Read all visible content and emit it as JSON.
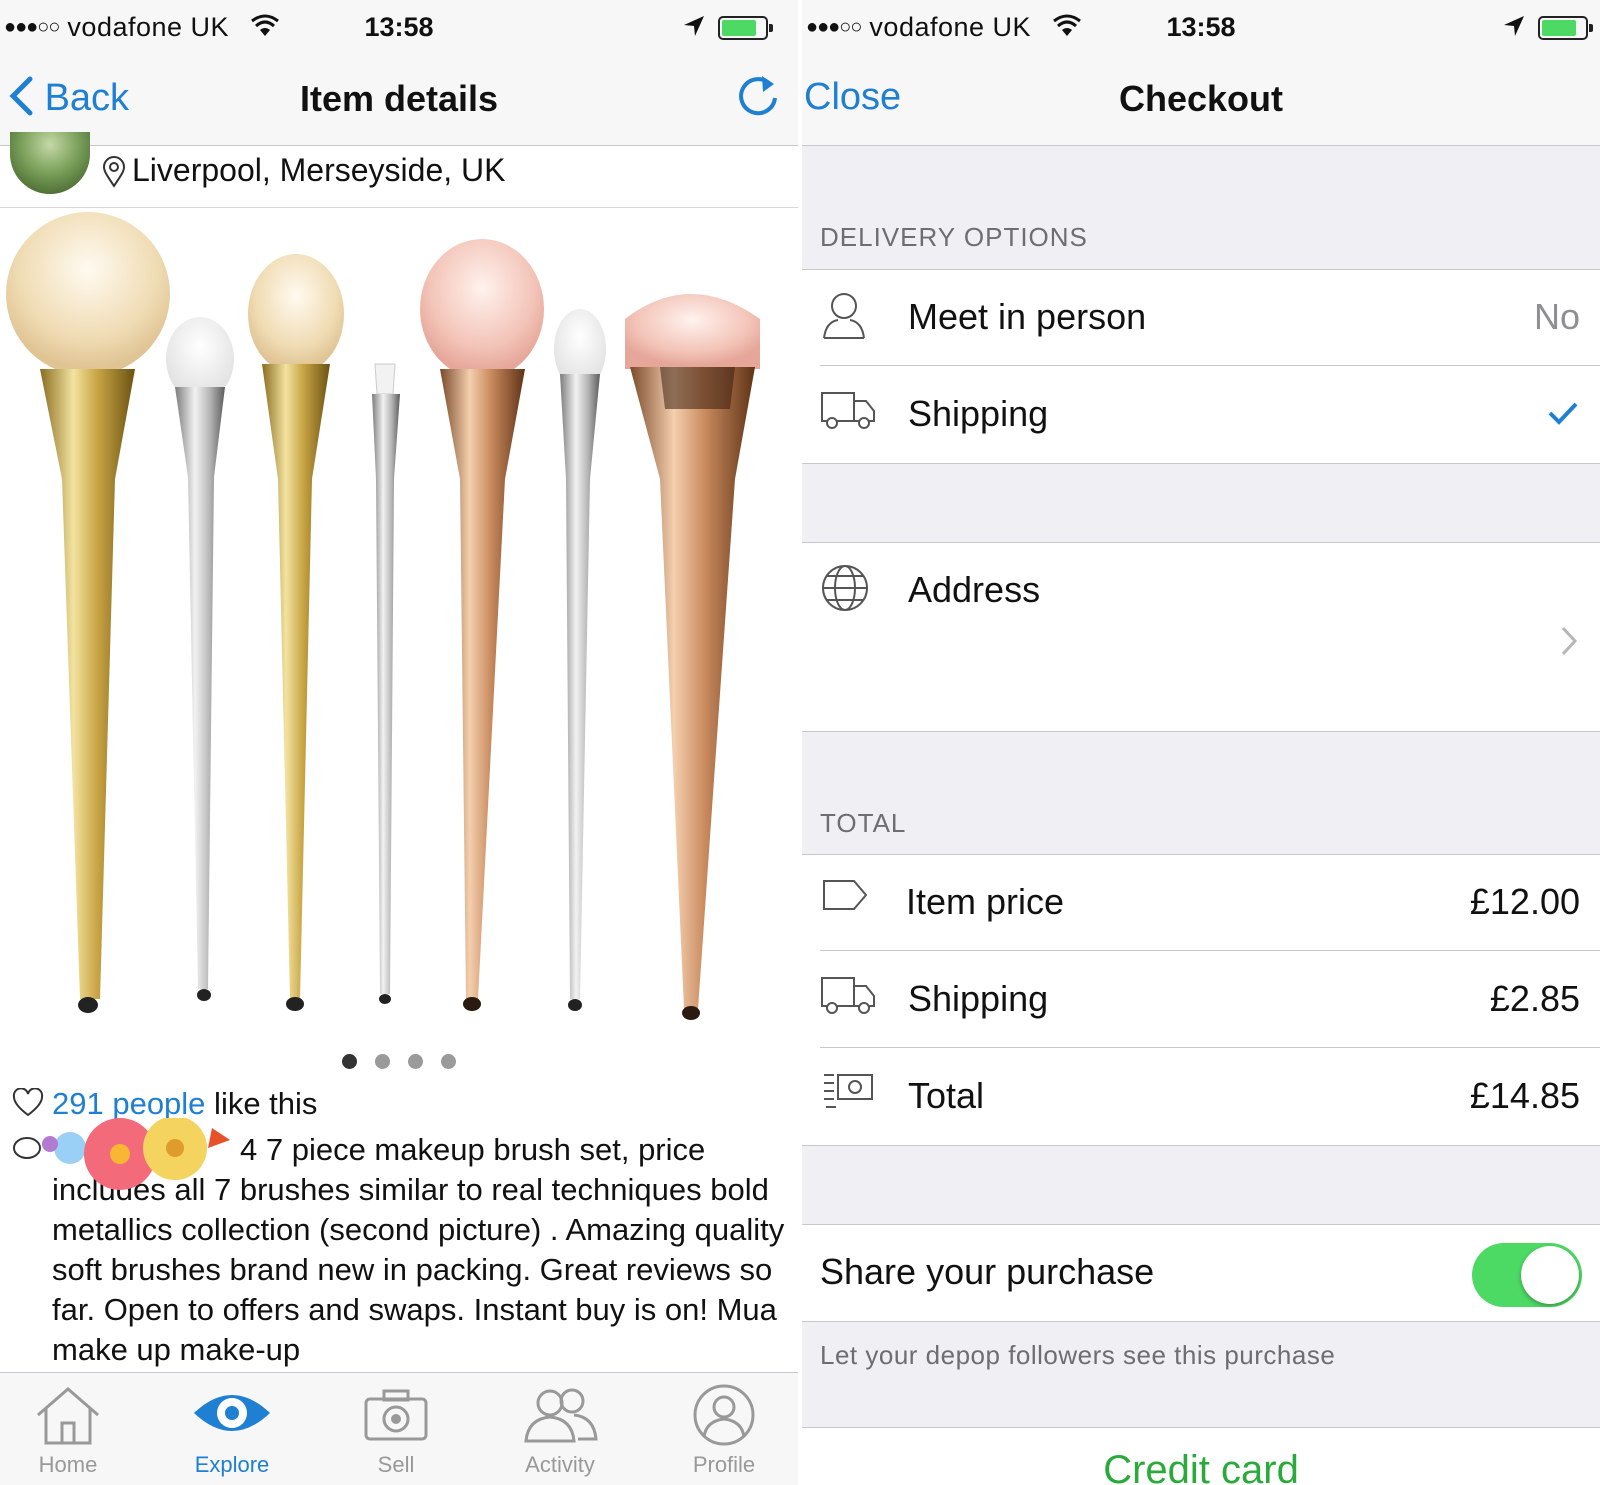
{
  "left": {
    "status": {
      "carrier": "vodafone UK",
      "signal": "●●●○○",
      "time": "13:58"
    },
    "nav": {
      "back_label": "Back",
      "title": "Item details",
      "refresh_icon": "refresh-icon"
    },
    "seller": {
      "location": "Liverpool, Merseyside, UK"
    },
    "gallery": {
      "page_count": 4,
      "active_page": 1
    },
    "likes": {
      "count_text": "291 people",
      "suffix": " like this"
    },
    "description": "4 7 piece makeup brush set, price includes all 7 brushes similar to real techniques bold metallics collection (second picture) . Amazing quality soft brushes brand new in packing. Great reviews so far. Open to offers and swaps. Instant buy is on! Mua make up make-up",
    "tabs": [
      {
        "label": "Home",
        "icon": "home-icon"
      },
      {
        "label": "Explore",
        "icon": "eye-icon",
        "active": true
      },
      {
        "label": "Sell",
        "icon": "camera-icon"
      },
      {
        "label": "Activity",
        "icon": "people-icon"
      },
      {
        "label": "Profile",
        "icon": "person-icon"
      }
    ]
  },
  "right": {
    "status": {
      "carrier": "vodafone UK",
      "signal": "●●●○○",
      "time": "13:58"
    },
    "nav": {
      "close_label": "Close",
      "title": "Checkout"
    },
    "delivery": {
      "header": "DELIVERY OPTIONS",
      "meet": {
        "label": "Meet in person",
        "value": "No"
      },
      "shipping": {
        "label": "Shipping",
        "selected": true
      }
    },
    "address": {
      "label": "Address"
    },
    "total": {
      "header": "TOTAL",
      "item_price": {
        "label": "Item price",
        "value": "£12.00"
      },
      "shipping": {
        "label": "Shipping",
        "value": "£2.85"
      },
      "total": {
        "label": "Total",
        "value": "£14.85"
      }
    },
    "share": {
      "label": "Share your purchase",
      "on": true,
      "footnote": "Let your depop followers see this purchase"
    },
    "payment": {
      "label": "Credit card"
    }
  },
  "colors": {
    "accent": "#1e7fd3",
    "toggle_on": "#4cd964",
    "credit_card": "#2aaa3a",
    "background": "#efeff4"
  }
}
